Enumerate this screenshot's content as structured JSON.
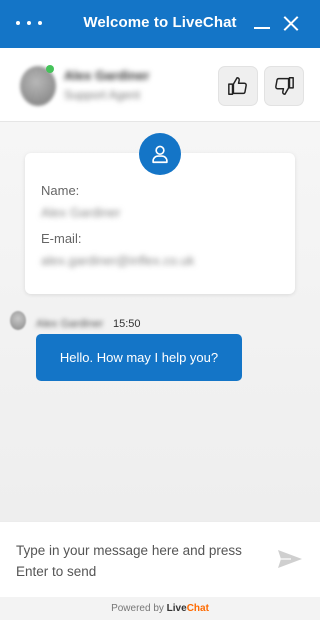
{
  "window": {
    "title": "Welcome to LiveChat",
    "menu_icon": "more-dots-icon",
    "minimize_icon": "minimize-icon",
    "close_icon": "close-icon"
  },
  "agent": {
    "name": "Alex Gardiner",
    "role": "Support Agent",
    "status_color": "#45c35a",
    "rate_good_icon": "thumbs-up-icon",
    "rate_bad_icon": "thumbs-down-icon"
  },
  "contact_card": {
    "icon": "user-icon",
    "name_label": "Name:",
    "name_value": "Alex Gardiner",
    "email_label": "E-mail:",
    "email_value": "alex.gardiner@inflex.co.uk"
  },
  "messages": [
    {
      "author": "Alex Gardiner",
      "time": "15:50",
      "text": "Hello. How may I help you?"
    }
  ],
  "composer": {
    "placeholder": "Type in your message here and press Enter to send",
    "send_icon": "send-icon"
  },
  "footer": {
    "powered_by": "Powered by",
    "brand_live": "Live",
    "brand_chat": "Chat"
  },
  "colors": {
    "accent": "#1475c7",
    "brand_orange": "#ff6a00"
  }
}
